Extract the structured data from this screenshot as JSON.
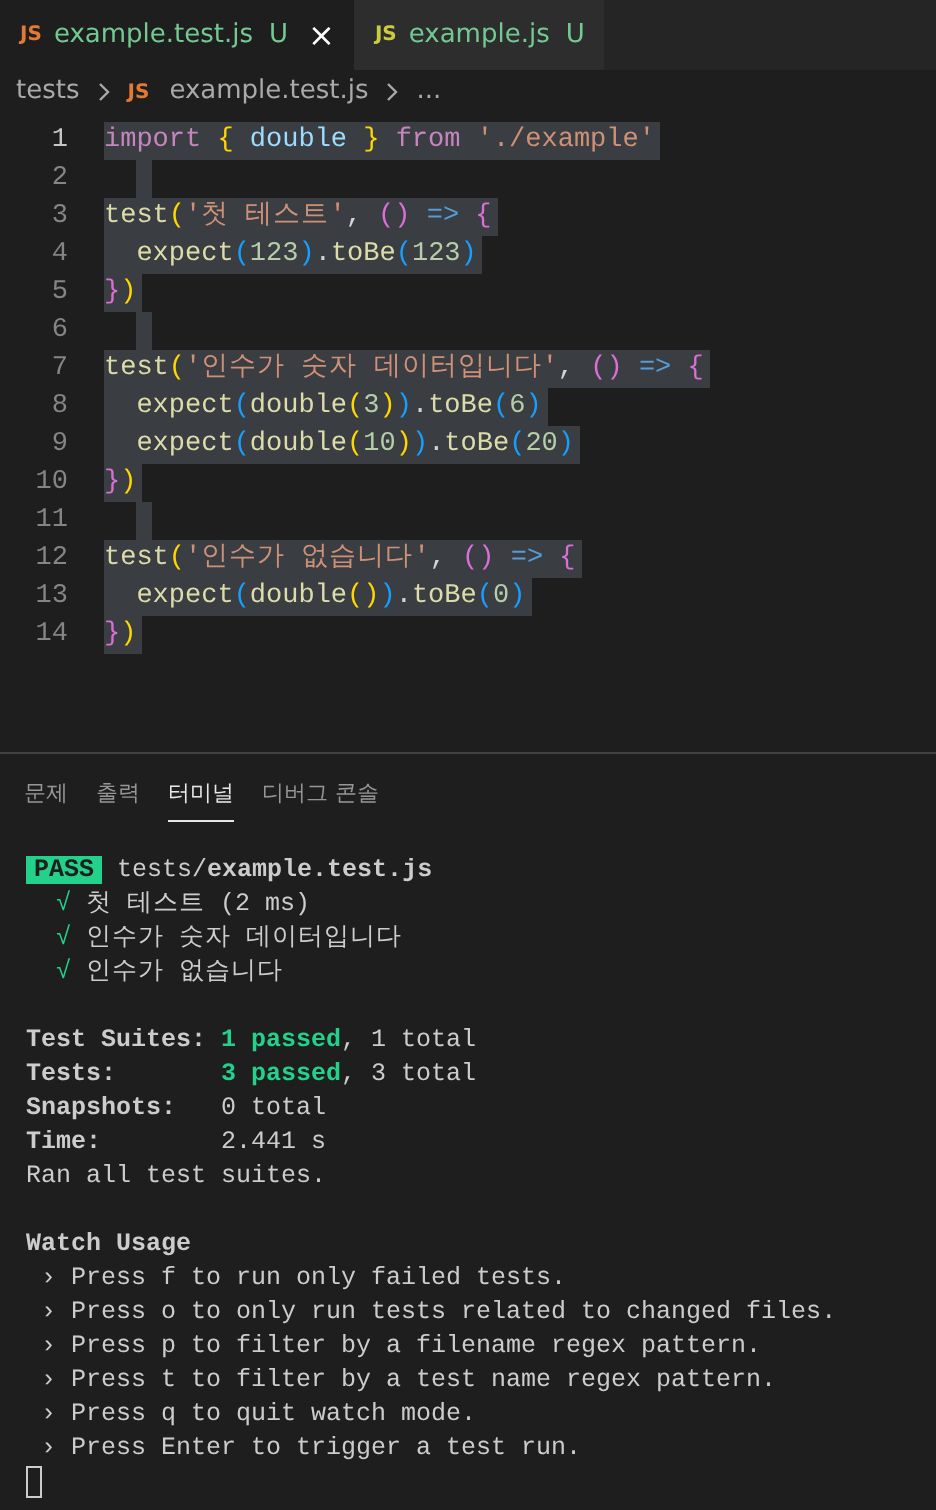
{
  "tabs": [
    {
      "icon": "JS",
      "color": "#e37933",
      "label": "example.test.js",
      "status": "U",
      "selected": true,
      "close": "×"
    },
    {
      "icon": "JS",
      "color": "#cbcb41",
      "label": "example.js",
      "status": "U",
      "selected": false
    }
  ],
  "breadcrumb": [
    "tests",
    {
      "icon": "JS",
      "label": "example.test.js"
    },
    "..."
  ],
  "editor": {
    "selected": true,
    "lines": [
      {
        "number": "1",
        "active": true,
        "tokens": [
          {
            "kind": "kw",
            "text": "import"
          },
          {
            "kind": "b1",
            "text": " {"
          },
          {
            "kind": "var",
            "text": " double"
          },
          {
            "kind": "b1",
            "text": " }"
          },
          {
            "kind": "kw",
            "text": " from"
          },
          {
            "kind": "str",
            "text": " './example'"
          }
        ]
      },
      {
        "number": "2",
        "active": false
      },
      {
        "number": "3",
        "active": false,
        "tokens": [
          {
            "kind": "fn",
            "text": "test"
          },
          {
            "kind": "b1",
            "text": "("
          },
          {
            "kind": "str",
            "text": "'첫 테스트'"
          },
          {
            "kind": "p",
            "text": ","
          },
          {
            "kind": "b2",
            "text": " ()"
          },
          {
            "kind": "arrow",
            "text": " =>"
          },
          {
            "kind": "b2",
            "text": " {"
          }
        ]
      },
      {
        "number": "4",
        "active": false,
        "tokens": [
          {
            "kind": "fn",
            "text": "  expect"
          },
          {
            "kind": "b3",
            "text": "("
          },
          {
            "kind": "num",
            "text": "123"
          },
          {
            "kind": "b3",
            "text": ")"
          },
          {
            "kind": "p",
            "text": "."
          },
          {
            "kind": "fn",
            "text": "toBe"
          },
          {
            "kind": "b3",
            "text": "("
          },
          {
            "kind": "num",
            "text": "123"
          },
          {
            "kind": "b3",
            "text": ")"
          }
        ]
      },
      {
        "number": "5",
        "active": false,
        "tokens": [
          {
            "kind": "b2",
            "text": "}"
          },
          {
            "kind": "b1",
            "text": ")"
          }
        ]
      },
      {
        "number": "6",
        "active": false
      },
      {
        "number": "7",
        "active": false,
        "tokens": [
          {
            "kind": "fn",
            "text": "test"
          },
          {
            "kind": "b1",
            "text": "("
          },
          {
            "kind": "str",
            "text": "'인수가 숫자 데이터입니다'"
          },
          {
            "kind": "p",
            "text": ","
          },
          {
            "kind": "b2",
            "text": " ()"
          },
          {
            "kind": "arrow",
            "text": " =>"
          },
          {
            "kind": "b2",
            "text": " {"
          }
        ]
      },
      {
        "number": "8",
        "active": false,
        "tokens": [
          {
            "kind": "fn",
            "text": "  expect"
          },
          {
            "kind": "b3",
            "text": "("
          },
          {
            "kind": "fn",
            "text": "double"
          },
          {
            "kind": "b1",
            "text": "("
          },
          {
            "kind": "num",
            "text": "3"
          },
          {
            "kind": "b1",
            "text": ")"
          },
          {
            "kind": "b3",
            "text": ")"
          },
          {
            "kind": "p",
            "text": "."
          },
          {
            "kind": "fn",
            "text": "toBe"
          },
          {
            "kind": "b3",
            "text": "("
          },
          {
            "kind": "num",
            "text": "6"
          },
          {
            "kind": "b3",
            "text": ")"
          }
        ]
      },
      {
        "number": "9",
        "active": false,
        "tokens": [
          {
            "kind": "fn",
            "text": "  expect"
          },
          {
            "kind": "b3",
            "text": "("
          },
          {
            "kind": "fn",
            "text": "double"
          },
          {
            "kind": "b1",
            "text": "("
          },
          {
            "kind": "num",
            "text": "10"
          },
          {
            "kind": "b1",
            "text": ")"
          },
          {
            "kind": "b3",
            "text": ")"
          },
          {
            "kind": "p",
            "text": "."
          },
          {
            "kind": "fn",
            "text": "toBe"
          },
          {
            "kind": "b3",
            "text": "("
          },
          {
            "kind": "num",
            "text": "20"
          },
          {
            "kind": "b3",
            "text": ")"
          }
        ]
      },
      {
        "number": "10",
        "active": false,
        "tokens": [
          {
            "kind": "b2",
            "text": "}"
          },
          {
            "kind": "b1",
            "text": ")"
          }
        ]
      },
      {
        "number": "11",
        "active": false
      },
      {
        "number": "12",
        "active": false,
        "tokens": [
          {
            "kind": "fn",
            "text": "test"
          },
          {
            "kind": "b1",
            "text": "("
          },
          {
            "kind": "str",
            "text": "'인수가 없습니다'"
          },
          {
            "kind": "p",
            "text": ","
          },
          {
            "kind": "b2",
            "text": " ()"
          },
          {
            "kind": "arrow",
            "text": " =>"
          },
          {
            "kind": "b2",
            "text": " {"
          }
        ]
      },
      {
        "number": "13",
        "active": false,
        "tokens": [
          {
            "kind": "fn",
            "text": "  expect"
          },
          {
            "kind": "b3",
            "text": "("
          },
          {
            "kind": "fn",
            "text": "double"
          },
          {
            "kind": "b1",
            "text": "()"
          },
          {
            "kind": "b3",
            "text": ")"
          },
          {
            "kind": "p",
            "text": "."
          },
          {
            "kind": "fn",
            "text": "toBe"
          },
          {
            "kind": "b3",
            "text": "("
          },
          {
            "kind": "num",
            "text": "0"
          },
          {
            "kind": "b3",
            "text": ")"
          }
        ]
      },
      {
        "number": "14",
        "active": false,
        "tokens": [
          {
            "kind": "b2",
            "text": "}"
          },
          {
            "kind": "b1",
            "text": ")"
          }
        ]
      }
    ]
  },
  "panel_tabs": [
    {
      "label": "문제",
      "selected": false
    },
    {
      "label": "출력",
      "selected": false
    },
    {
      "label": "터미널",
      "selected": true
    },
    {
      "label": "디버그 콘솔",
      "selected": false
    }
  ],
  "terminal": {
    "badge": "PASS",
    "path": "tests/**example.test.js**",
    "results": [
      {
        "mark": "√",
        "text": "첫 테스트 (2 ms)"
      },
      {
        "mark": "√",
        "text": "인수가 숫자 데이터입니다"
      },
      {
        "mark": "√",
        "text": "인수가 없습니다"
      }
    ],
    "summary": [
      {
        "label": "Test Suites:",
        "passed": "1 passed",
        "rest": ", 1 total"
      },
      {
        "label": "Tests:",
        "passed": "3 passed",
        "rest": ", 3 total"
      },
      {
        "label": "Snapshots:",
        "rest": "0 total"
      },
      {
        "label": "Time:",
        "rest": "2.441 s"
      }
    ],
    "note": "Ran all test suites.",
    "watch_title": "Watch Usage",
    "watch_items": [
      "› Press f to run only failed tests.",
      "› Press o to only run tests related to changed files.",
      "› Press p to filter by a filename regex pattern.",
      "› Press t to filter by a test name regex pattern.",
      "› Press q to quit watch mode.",
      "› Press Enter to trigger a test run."
    ]
  }
}
